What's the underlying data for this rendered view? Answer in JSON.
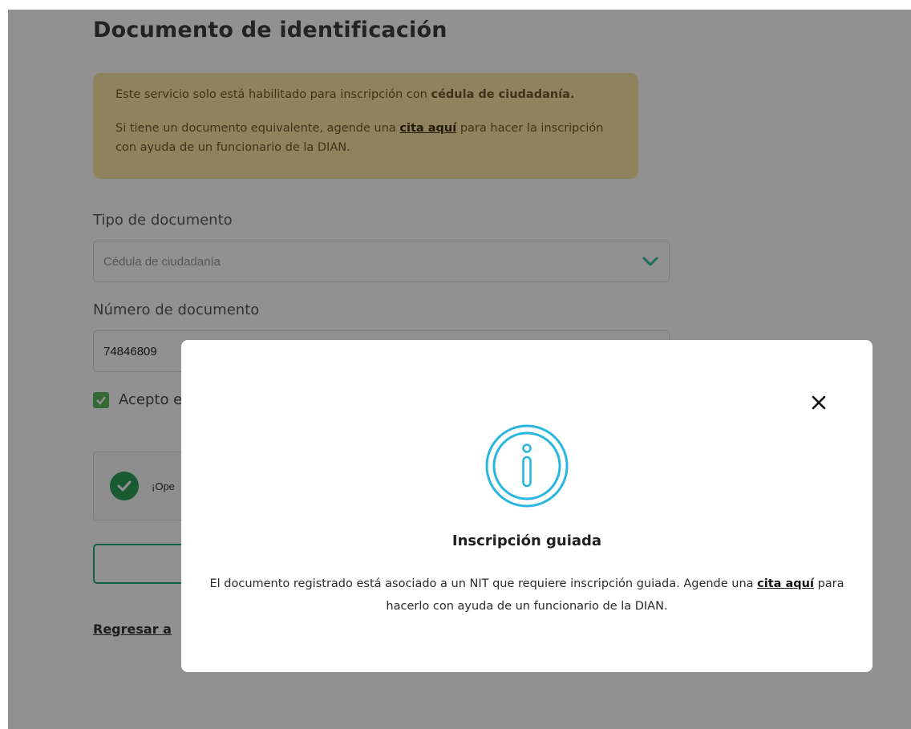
{
  "page": {
    "title": "Documento de identificación",
    "alert": {
      "line1_prefix": "Este servicio solo está habilitado para inscripción con ",
      "line1_bold": "cédula de ciudadanía.",
      "line2_prefix": "Si tiene un documento equivalente, agende una ",
      "line2_link": "cita aquí",
      "line2_suffix": " para hacer la inscripción con ayuda de un funcionario de la DIAN."
    },
    "doc_type_label": "Tipo de documento",
    "doc_type_value": "Cédula de ciudadanía",
    "doc_number_label": "Número de documento",
    "doc_number_value": "74846809",
    "accept_label": "Acepto e",
    "captcha_text": "¡Ope",
    "back_button_label": "<",
    "back_link": "Regresar a"
  },
  "modal": {
    "title": "Inscripción guiada",
    "body_prefix": "El documento registrado está asociado a un NIT que requiere inscripción guiada. Agende una ",
    "body_link": "cita aquí",
    "body_suffix": " para hacerlo con ayuda de un funcionario de la DIAN.",
    "close_icon": "close-icon",
    "info_icon": "info-icon"
  },
  "colors": {
    "overlay": "rgba(0,0,0,0.43)",
    "alert_bg": "#fbe7a8",
    "accent_green": "#20a67a",
    "info_blue": "#29b6e0"
  }
}
